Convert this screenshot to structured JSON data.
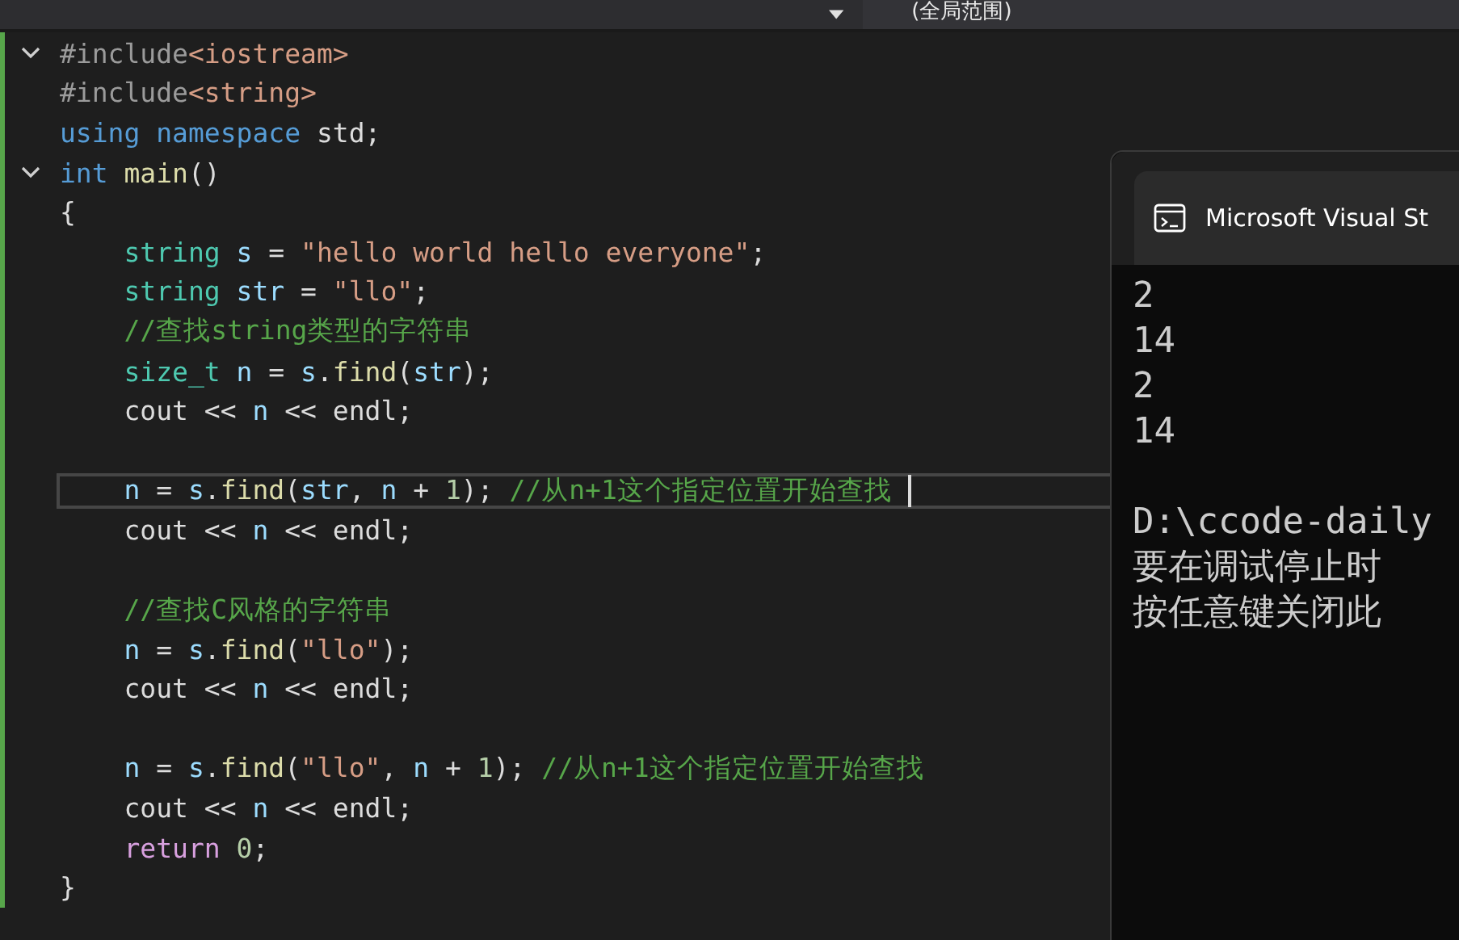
{
  "toolbar": {
    "scope_dropdown": "(全局范围)"
  },
  "editor": {
    "lines": [
      {
        "current": false,
        "expanded": true,
        "tokens": [
          {
            "text": "#include",
            "kind": "preproc"
          },
          {
            "text": "<iostream>",
            "kind": "string"
          }
        ]
      },
      {
        "current": false,
        "tokens": [
          {
            "text": "#include",
            "kind": "preproc"
          },
          {
            "text": "<string>",
            "kind": "string"
          }
        ]
      },
      {
        "current": false,
        "tokens": [
          {
            "text": "using namespace",
            "kind": "keyword"
          },
          {
            "text": " std;",
            "kind": "plain"
          }
        ]
      },
      {
        "current": false,
        "expanded": true,
        "tokens": [
          {
            "text": "int",
            "kind": "keyword"
          },
          {
            "text": " main",
            "kind": "func"
          },
          {
            "text": "()",
            "kind": "plain"
          }
        ]
      },
      {
        "current": false,
        "tokens": [
          {
            "text": "{",
            "kind": "plain"
          }
        ]
      },
      {
        "current": false,
        "tokens": [
          {
            "text": "    string",
            "kind": "type"
          },
          {
            "text": " s",
            "kind": "var"
          },
          {
            "text": " = ",
            "kind": "plain"
          },
          {
            "text": "\"hello world hello everyone\"",
            "kind": "string"
          },
          {
            "text": ";",
            "kind": "plain"
          }
        ]
      },
      {
        "current": false,
        "tokens": [
          {
            "text": "    string",
            "kind": "type"
          },
          {
            "text": " str",
            "kind": "var"
          },
          {
            "text": " = ",
            "kind": "plain"
          },
          {
            "text": "\"llo\"",
            "kind": "string"
          },
          {
            "text": ";",
            "kind": "plain"
          }
        ]
      },
      {
        "current": false,
        "tokens": [
          {
            "text": "    //查找string类型的字符串",
            "kind": "comment"
          }
        ]
      },
      {
        "current": false,
        "tokens": [
          {
            "text": "    size_t",
            "kind": "type"
          },
          {
            "text": " n",
            "kind": "var"
          },
          {
            "text": " = ",
            "kind": "plain"
          },
          {
            "text": "s",
            "kind": "var"
          },
          {
            "text": ".",
            "kind": "plain"
          },
          {
            "text": "find",
            "kind": "func"
          },
          {
            "text": "(",
            "kind": "plain"
          },
          {
            "text": "str",
            "kind": "var"
          },
          {
            "text": ");",
            "kind": "plain"
          }
        ]
      },
      {
        "current": false,
        "tokens": [
          {
            "text": "    cout << ",
            "kind": "plain"
          },
          {
            "text": "n",
            "kind": "var"
          },
          {
            "text": " << endl;",
            "kind": "plain"
          }
        ]
      },
      {
        "current": false
      },
      {
        "current": true,
        "tokens": [
          {
            "text": "    n",
            "kind": "var"
          },
          {
            "text": " = ",
            "kind": "plain"
          },
          {
            "text": "s",
            "kind": "var"
          },
          {
            "text": ".",
            "kind": "plain"
          },
          {
            "text": "find",
            "kind": "func"
          },
          {
            "text": "(",
            "kind": "plain"
          },
          {
            "text": "str",
            "kind": "var"
          },
          {
            "text": ", ",
            "kind": "plain"
          },
          {
            "text": "n",
            "kind": "var"
          },
          {
            "text": " + ",
            "kind": "plain"
          },
          {
            "text": "1",
            "kind": "number"
          },
          {
            "text": "); ",
            "kind": "plain"
          },
          {
            "text": "//从n+1这个指定位置开始查找 ",
            "kind": "comment"
          }
        ]
      },
      {
        "current": false,
        "tokens": [
          {
            "text": "    cout << ",
            "kind": "plain"
          },
          {
            "text": "n",
            "kind": "var"
          },
          {
            "text": " << endl;",
            "kind": "plain"
          }
        ]
      },
      {
        "current": false
      },
      {
        "current": false,
        "tokens": [
          {
            "text": "    //查找C风格的字符串",
            "kind": "comment"
          }
        ]
      },
      {
        "current": false,
        "tokens": [
          {
            "text": "    n",
            "kind": "var"
          },
          {
            "text": " = ",
            "kind": "plain"
          },
          {
            "text": "s",
            "kind": "var"
          },
          {
            "text": ".",
            "kind": "plain"
          },
          {
            "text": "find",
            "kind": "func"
          },
          {
            "text": "(",
            "kind": "plain"
          },
          {
            "text": "\"llo\"",
            "kind": "string"
          },
          {
            "text": ");",
            "kind": "plain"
          }
        ]
      },
      {
        "current": false,
        "tokens": [
          {
            "text": "    cout << ",
            "kind": "plain"
          },
          {
            "text": "n",
            "kind": "var"
          },
          {
            "text": " << endl;",
            "kind": "plain"
          }
        ]
      },
      {
        "current": false
      },
      {
        "current": false,
        "tokens": [
          {
            "text": "    n",
            "kind": "var"
          },
          {
            "text": " = ",
            "kind": "plain"
          },
          {
            "text": "s",
            "kind": "var"
          },
          {
            "text": ".",
            "kind": "plain"
          },
          {
            "text": "find",
            "kind": "func"
          },
          {
            "text": "(",
            "kind": "plain"
          },
          {
            "text": "\"llo\"",
            "kind": "string"
          },
          {
            "text": ", ",
            "kind": "plain"
          },
          {
            "text": "n",
            "kind": "var"
          },
          {
            "text": " + ",
            "kind": "plain"
          },
          {
            "text": "1",
            "kind": "number"
          },
          {
            "text": "); ",
            "kind": "plain"
          },
          {
            "text": "//从n+1这个指定位置开始查找",
            "kind": "comment"
          }
        ]
      },
      {
        "current": false,
        "tokens": [
          {
            "text": "    cout << ",
            "kind": "plain"
          },
          {
            "text": "n",
            "kind": "var"
          },
          {
            "text": " << endl;",
            "kind": "plain"
          }
        ]
      },
      {
        "current": false,
        "tokens": [
          {
            "text": "    return",
            "kind": "control"
          },
          {
            "text": " 0",
            "kind": "number"
          },
          {
            "text": ";",
            "kind": "plain"
          }
        ]
      },
      {
        "current": false,
        "tokens": [
          {
            "text": "}",
            "kind": "plain"
          }
        ]
      }
    ]
  },
  "console": {
    "title": "Microsoft Visual St",
    "output_blocks": [
      [
        "2",
        "14",
        "2",
        "14"
      ],
      [
        "D:\\ccode-daily",
        "要在调试停止时",
        "按任意键关闭此"
      ]
    ]
  }
}
